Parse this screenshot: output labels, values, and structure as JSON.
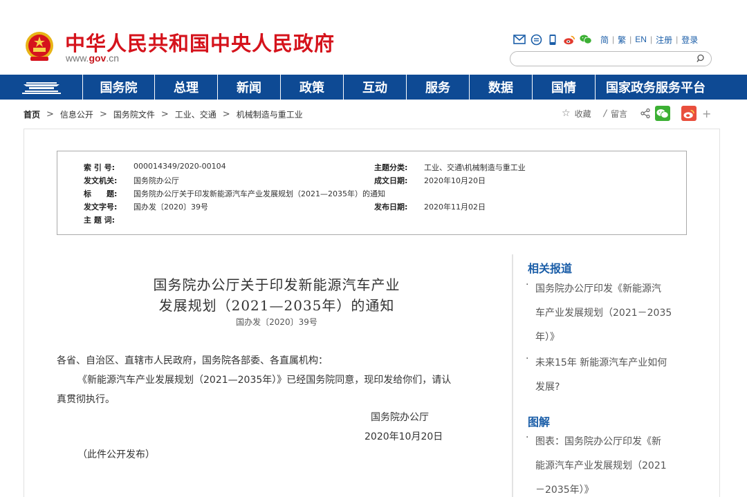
{
  "header": {
    "site_title": "中华人民共和国中央人民政府",
    "url_prefix": "www.",
    "url_brand": "gov",
    "url_suffix": ".cn",
    "lang_links": [
      "简",
      "繁",
      "EN",
      "注册",
      "登录"
    ],
    "search_placeholder": ""
  },
  "nav": {
    "items": [
      "国务院",
      "总理",
      "新闻",
      "政策",
      "互动",
      "服务",
      "数据",
      "国情",
      "国家政务服务平台"
    ]
  },
  "breadcrumb": {
    "items": [
      "首页",
      "信息公开",
      "国务院文件",
      "工业、交通",
      "机械制造与重工业"
    ]
  },
  "share": {
    "favorite": "收藏",
    "comment": "留言"
  },
  "info": {
    "index_label": "索 引 号:",
    "index_value": "000014349/2020-00104",
    "issuer_label": "发文机关:",
    "issuer_value": "国务院办公厅",
    "title_label": "标　　题:",
    "title_value": "国务院办公厅关于印发新能源汽车产业发展规划（2021—2035年）的通知",
    "docno_label": "发文字号:",
    "docno_value": "国办发〔2020〕39号",
    "keywords_label": "主 题 词:",
    "category_label": "主题分类:",
    "category_value": "工业、交通\\机械制造与重工业",
    "written_label": "成文日期:",
    "written_value": "2020年10月20日",
    "published_label": "发布日期:",
    "published_value": "2020年11月02日"
  },
  "article": {
    "title_line1": "国务院办公厅关于印发新能源汽车产业",
    "title_line2": "发展规划（2021—2035年）的通知",
    "doc_no": "国办发〔2020〕39号",
    "salutation": "各省、自治区、直辖市人民政府，国务院各部委、各直属机构：",
    "body_line1": "《新能源汽车产业发展规划（2021—2035年）》已经国务院同意，现印发给你们，请认",
    "body_line2": "真贯彻执行。",
    "signature": "国务院办公厅",
    "date": "2020年10月20日",
    "note": "（此件公开发布）"
  },
  "sidebar": {
    "related_head": "相关报道",
    "related": [
      [
        "国务院办公厅印发《新能源汽",
        "车产业发展规划（2021－2035",
        "年）》"
      ],
      [
        "未来15年 新能源汽车产业如何",
        "发展?"
      ]
    ],
    "graphic_head": "图解",
    "graphics": [
      [
        "图表：国务院办公厅印发《新",
        "能源汽车产业发展规划（2021",
        "－2035年）》"
      ]
    ]
  },
  "colors": {
    "brand_red": "#d5131c",
    "nav_blue": "#0e4a94",
    "link_blue": "#1b5ea8"
  }
}
